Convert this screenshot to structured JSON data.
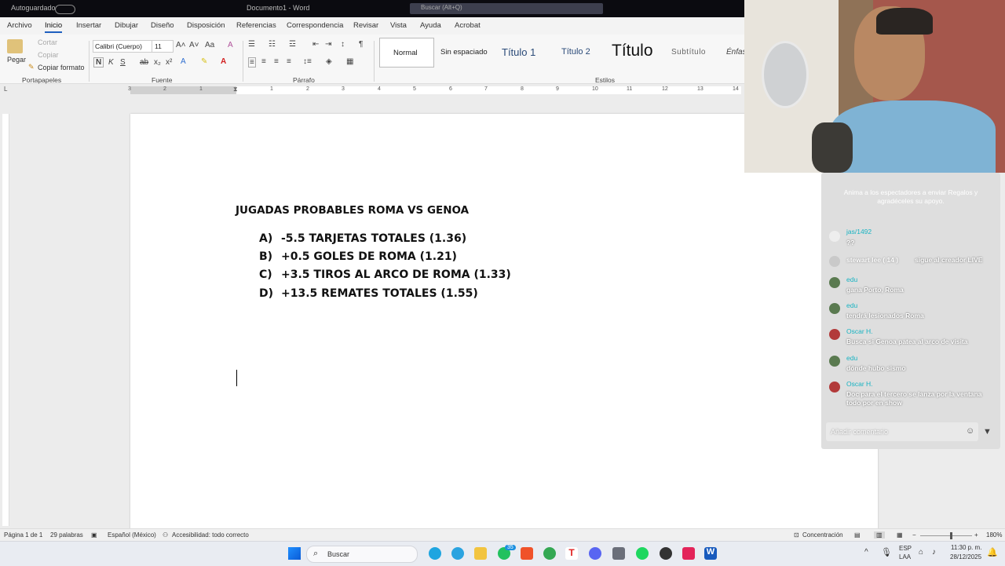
{
  "titlebar": {
    "autosave": "Autoguardado",
    "doc_title": "Documento1 - Word",
    "search_placeholder": "Buscar (Alt+Q)"
  },
  "menu_tabs": [
    "Archivo",
    "Inicio",
    "Insertar",
    "Dibujar",
    "Diseño",
    "Disposición",
    "Referencias",
    "Correspondencia",
    "Revisar",
    "Vista",
    "Ayuda",
    "Acrobat"
  ],
  "ribbon": {
    "clipboard": {
      "paste": "Pegar",
      "cut": "Cortar",
      "copy": "Copiar",
      "format_painter": "Copiar formato",
      "group": "Portapapeles"
    },
    "font": {
      "name": "Calibri (Cuerpo)",
      "size": "11",
      "group": "Fuente",
      "bold": "N",
      "italic": "K",
      "underline": "S"
    },
    "paragraph": {
      "group": "Párrafo"
    },
    "styles": {
      "group": "Estilos",
      "items": [
        "Normal",
        "Sin espaciado",
        "Título 1",
        "Título 2",
        "Título",
        "Subtítulo",
        "Énfas"
      ]
    }
  },
  "ruler": {
    "numbers": [
      "3",
      "2",
      "1",
      "1",
      "2",
      "3",
      "4",
      "5",
      "6",
      "7",
      "8",
      "9",
      "10",
      "11",
      "12",
      "13",
      "14"
    ]
  },
  "document": {
    "title": "JUGADAS PROBABLES ROMA VS GENOA",
    "items": [
      {
        "letter": "A)",
        "text": "-5.5 TARJETAS TOTALES (1.36)"
      },
      {
        "letter": "B)",
        "text": "+0.5 GOLES DE ROMA (1.21)"
      },
      {
        "letter": "C)",
        "text": "+3.5 TIROS AL ARCO DE ROMA (1.33)"
      },
      {
        "letter": "D)",
        "text": "+13.5 REMATES TOTALES (1.55)"
      }
    ]
  },
  "statusbar": {
    "page": "Página 1 de 1",
    "words": "29 palabras",
    "language": "Español (México)",
    "accessibility": "Accesibilidad: todo correcto",
    "focus": "Concentración",
    "zoom": "180%"
  },
  "taskbar": {
    "search": "Buscar",
    "lang1": "ESP",
    "lang2": "LAA",
    "time": "11:30 p. m.",
    "date": "28/12/2025",
    "badge": "35"
  },
  "chat": {
    "tip": "Anima a los espectadores a enviar Regalos y agradéceles su apoyo.",
    "messages": [
      {
        "user": "jas/1492",
        "text": "??"
      },
      {
        "user": "stewart lee ( 14 )",
        "text": "sigue al creador LIVE"
      },
      {
        "user": "edu",
        "text": "gana Porto, Roma"
      },
      {
        "user": "edu",
        "text": "tendrá lesionados Roma"
      },
      {
        "user": "Oscar H.",
        "text": "Busca si Genoa patea al arco de visita"
      },
      {
        "user": "edu",
        "text": "dónde hubo sismo"
      },
      {
        "user": "Oscar H.",
        "text": "Doc para el tercero se lanza por la ventana",
        "text2": "todo por en show"
      }
    ],
    "input_placeholder": "Añadir comentario"
  },
  "colors": {
    "accent": "#1e5fbf",
    "chat_user": "#17b3c2",
    "word_blue": "#185abd"
  }
}
